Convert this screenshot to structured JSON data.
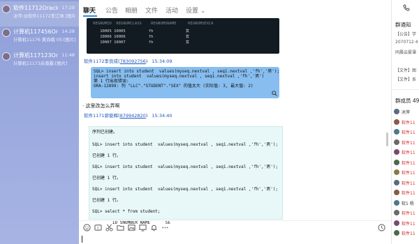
{
  "conversations": [
    {
      "name": "软件11712Oracle",
      "time": "17:29",
      "preview": "冰萍:@软件11172李江帅 [图片]"
    },
    {
      "name": "计算机117456Orac…",
      "time": "14:28",
      "preview": "计算机11176 黄尚峨 05:[图片]"
    },
    {
      "name": "计算机117123Orac…",
      "time": "11:48",
      "preview": "计算机11173杀南霸:[图片]"
    }
  ],
  "tabs": [
    "聊天",
    "公告",
    "相册",
    "文件",
    "活动",
    "设置 ⌄"
  ],
  "code_dark": {
    "header": " REGNUMID  REGNUMCLASS    REGNUMSNAME     REGNUMSEXCA",
    "rows": [
      "    10005 10005          fh              女",
      "    10006 10006          fh              女",
      "    10007 10007          fh              女"
    ]
  },
  "msg1": {
    "sender": "软件1172李良成",
    "qq": "783092756",
    "time": "15:34:09"
  },
  "bubble_blue": [
    "SQL> insert into student  values(myseq.nextval , seq1.nextval ,'fh','男');",
    "insert into student  values(myseq.nextval , seq1.nextval ,'fh','男')",
    "",
    "第 1 行出现错误:",
    "ORA-12899: 列 \"LLC\".\"STUDENT\".\"SEX\" 的值太大 (实际值: 3, 最大值: 2)"
  ],
  "plain_msg": "这里改怎么弄啊",
  "msg2": {
    "sender": "软件1171郭俊辉",
    "qq": "879942820",
    "time": "15:34:40"
  },
  "bubble_green": [
    "序列已创建。",
    "SQL> insert into student  values(myseq.nextval , seq1.nextval ,'fh','男');",
    "已创建 1 行。",
    "SQL> insert into student  values(myseq.nextval , seq1.nextval ,'fh','男');",
    "已创建 1 行。",
    "SQL> insert into student  values(myseq.nextval , seq1.nextval ,'fh','男');",
    "已创建 1 行。",
    "SQL> select * from student;",
    "        ID SNUMBER NAME      SE"
  ],
  "right_panel": {
    "notice_title": "群通知",
    "notice_lines": [
      "【公告】学",
      "2070712 4",
      "同晨云雾课",
      "【文件】图",
      "【文件】系"
    ],
    "members_title": "群成员 49",
    "members": [
      {
        "name": "冰萍",
        "color": "#333333"
      },
      {
        "name": "软件11",
        "color": "#d12a2a"
      },
      {
        "name": "软件11",
        "color": "#d12a2a"
      },
      {
        "name": "软件11",
        "color": "#d12a2a"
      },
      {
        "name": "软件11",
        "color": "#d12a2a"
      },
      {
        "name": "软件11",
        "color": "#d12a2a"
      },
      {
        "name": "软件11",
        "color": "#d12a2a"
      },
      {
        "name": "软件11",
        "color": "#d12a2a"
      },
      {
        "name": "软件11",
        "color": "#d12a2a"
      },
      {
        "name": "软1 杨",
        "color": "#333333"
      },
      {
        "name": "软件11",
        "color": "#d12a2a"
      },
      {
        "name": "软件11",
        "color": "#d12a2a"
      },
      {
        "name": "软件11",
        "color": "#d12a2a"
      }
    ]
  },
  "colors": {
    "accent": "#2a8cdf",
    "sidebar": "#a7b4e4",
    "bubble_blue": "#87bdef",
    "bubble_code": "#e8f8f8"
  }
}
